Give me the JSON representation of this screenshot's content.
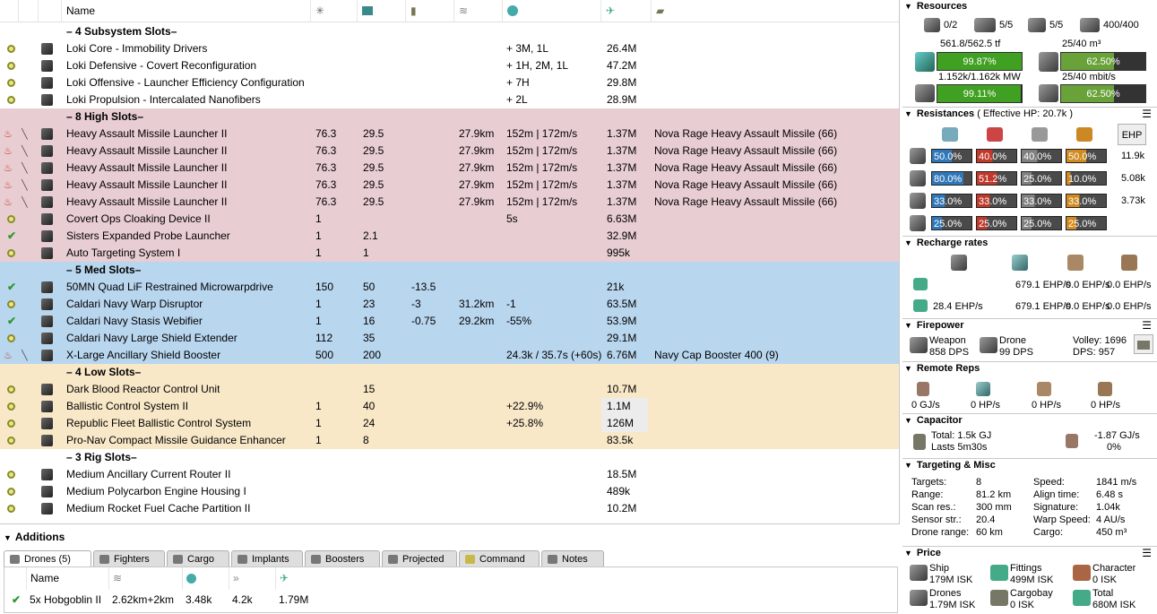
{
  "fitting": {
    "columns": {
      "name": "Name"
    },
    "rows": [
      {
        "type": "section",
        "label": "– 4 Subsystem Slots–",
        "bg": "white"
      },
      {
        "type": "mod",
        "state": "active",
        "name": "Loki Core - Immobility Drivers",
        "col5": "",
        "col6": "",
        "col7": "",
        "col8": "",
        "col9": "+ 3M, 1L",
        "price": "26.4M",
        "charge": "",
        "bg": "white"
      },
      {
        "type": "mod",
        "state": "active",
        "name": "Loki Defensive - Covert Reconfiguration",
        "col5": "",
        "col6": "",
        "col7": "",
        "col8": "",
        "col9": "+ 1H, 2M, 1L",
        "price": "47.2M",
        "charge": "",
        "bg": "white"
      },
      {
        "type": "mod",
        "state": "active",
        "name": "Loki Offensive - Launcher Efficiency Configuration",
        "col5": "",
        "col6": "",
        "col7": "",
        "col8": "",
        "col9": "+ 7H",
        "price": "29.8M",
        "charge": "",
        "bg": "white"
      },
      {
        "type": "mod",
        "state": "active",
        "name": "Loki Propulsion - Intercalated Nanofibers",
        "col5": "",
        "col6": "",
        "col7": "",
        "col8": "",
        "col9": "+ 2L",
        "price": "28.9M",
        "charge": "",
        "bg": "white"
      },
      {
        "type": "section",
        "label": "– 8 High Slots–",
        "bg": "pink"
      },
      {
        "type": "mod",
        "state": "overheat",
        "name": "Heavy Assault Missile Launcher II",
        "col5": "76.3",
        "col6": "29.5",
        "col7": "",
        "col8": "27.9km",
        "col9": "152m | 172m/s",
        "price": "1.37M",
        "charge": "Nova Rage Heavy Assault Missile (66)",
        "bg": "pink"
      },
      {
        "type": "mod",
        "state": "overheat",
        "name": "Heavy Assault Missile Launcher II",
        "col5": "76.3",
        "col6": "29.5",
        "col7": "",
        "col8": "27.9km",
        "col9": "152m | 172m/s",
        "price": "1.37M",
        "charge": "Nova Rage Heavy Assault Missile (66)",
        "bg": "pink"
      },
      {
        "type": "mod",
        "state": "overheat",
        "name": "Heavy Assault Missile Launcher II",
        "col5": "76.3",
        "col6": "29.5",
        "col7": "",
        "col8": "27.9km",
        "col9": "152m | 172m/s",
        "price": "1.37M",
        "charge": "Nova Rage Heavy Assault Missile (66)",
        "bg": "pink"
      },
      {
        "type": "mod",
        "state": "overheat",
        "name": "Heavy Assault Missile Launcher II",
        "col5": "76.3",
        "col6": "29.5",
        "col7": "",
        "col8": "27.9km",
        "col9": "152m | 172m/s",
        "price": "1.37M",
        "charge": "Nova Rage Heavy Assault Missile (66)",
        "bg": "pink"
      },
      {
        "type": "mod",
        "state": "overheat",
        "name": "Heavy Assault Missile Launcher II",
        "col5": "76.3",
        "col6": "29.5",
        "col7": "",
        "col8": "27.9km",
        "col9": "152m | 172m/s",
        "price": "1.37M",
        "charge": "Nova Rage Heavy Assault Missile (66)",
        "bg": "pink"
      },
      {
        "type": "mod",
        "state": "active",
        "name": "Covert Ops Cloaking Device II",
        "col5": "1",
        "col6": "",
        "col7": "",
        "col8": "",
        "col9": "5s",
        "price": "6.63M",
        "charge": "",
        "bg": "pink"
      },
      {
        "type": "mod",
        "state": "online",
        "name": "Sisters Expanded Probe Launcher",
        "col5": "1",
        "col6": "2.1",
        "col7": "",
        "col8": "",
        "col9": "",
        "price": "32.9M",
        "charge": "",
        "bg": "pink"
      },
      {
        "type": "mod",
        "state": "active",
        "name": "Auto Targeting System I",
        "col5": "1",
        "col6": "1",
        "col7": "",
        "col8": "",
        "col9": "",
        "price": "995k",
        "charge": "",
        "bg": "pink"
      },
      {
        "type": "section",
        "label": "– 5 Med Slots–",
        "bg": "blue"
      },
      {
        "type": "mod",
        "state": "online",
        "name": "50MN Quad LiF Restrained Microwarpdrive",
        "col5": "150",
        "col6": "50",
        "col7": "-13.5",
        "col8": "",
        "col9": "",
        "price": "21k",
        "charge": "",
        "bg": "blue"
      },
      {
        "type": "mod",
        "state": "active",
        "name": "Caldari Navy Warp Disruptor",
        "col5": "1",
        "col6": "23",
        "col7": "-3",
        "col8": "31.2km",
        "col9": "-1",
        "price": "63.5M",
        "charge": "",
        "bg": "blue"
      },
      {
        "type": "mod",
        "state": "online",
        "name": "Caldari Navy Stasis Webifier",
        "col5": "1",
        "col6": "16",
        "col7": "-0.75",
        "col8": "29.2km",
        "col9": "-55%",
        "price": "53.9M",
        "charge": "",
        "bg": "blue"
      },
      {
        "type": "mod",
        "state": "active",
        "name": "Caldari Navy Large Shield Extender",
        "col5": "112",
        "col6": "35",
        "col7": "",
        "col8": "",
        "col9": "",
        "price": "29.1M",
        "charge": "",
        "bg": "blue"
      },
      {
        "type": "mod",
        "state": "overheat",
        "name": "X-Large Ancillary Shield Booster",
        "col5": "500",
        "col6": "200",
        "col7": "",
        "col8": "",
        "col9": "24.3k / 35.7s (+60s)",
        "price": "6.76M",
        "charge": "Navy Cap Booster 400 (9)",
        "bg": "blue"
      },
      {
        "type": "section",
        "label": "– 4 Low Slots–",
        "bg": "tan"
      },
      {
        "type": "mod",
        "state": "active",
        "name": "Dark Blood Reactor Control Unit",
        "col5": "",
        "col6": "15",
        "col7": "",
        "col8": "",
        "col9": "",
        "price": "10.7M",
        "charge": "",
        "bg": "tan"
      },
      {
        "type": "mod",
        "state": "active",
        "name": "Ballistic Control System II",
        "col5": "1",
        "col6": "40",
        "col7": "",
        "col8": "",
        "col9": "+22.9%",
        "price": "1.1M",
        "charge": "",
        "bg": "tan",
        "pricebg": true
      },
      {
        "type": "mod",
        "state": "active",
        "name": "Republic Fleet Ballistic Control System",
        "col5": "1",
        "col6": "24",
        "col7": "",
        "col8": "",
        "col9": "+25.8%",
        "price": "126M",
        "charge": "",
        "bg": "tan",
        "pricebg": true
      },
      {
        "type": "mod",
        "state": "active",
        "name": "Pro-Nav Compact Missile Guidance Enhancer",
        "col5": "1",
        "col6": "8",
        "col7": "",
        "col8": "",
        "col9": "",
        "price": "83.5k",
        "charge": "",
        "bg": "tan"
      },
      {
        "type": "section",
        "label": "– 3 Rig Slots–",
        "bg": "white"
      },
      {
        "type": "mod",
        "state": "active",
        "name": "Medium Ancillary Current Router II",
        "col5": "",
        "col6": "",
        "col7": "",
        "col8": "",
        "col9": "",
        "price": "18.5M",
        "charge": "",
        "bg": "white"
      },
      {
        "type": "mod",
        "state": "active",
        "name": "Medium Polycarbon Engine Housing I",
        "col5": "",
        "col6": "",
        "col7": "",
        "col8": "",
        "col9": "",
        "price": "489k",
        "charge": "",
        "bg": "white"
      },
      {
        "type": "mod",
        "state": "active",
        "name": "Medium Rocket Fuel Cache Partition II",
        "col5": "",
        "col6": "",
        "col7": "",
        "col8": "",
        "col9": "",
        "price": "10.2M",
        "charge": "",
        "bg": "white"
      }
    ]
  },
  "additions": {
    "title": "Additions",
    "tabs": [
      "Drones (5)",
      "Fighters",
      "Cargo",
      "Implants",
      "Boosters",
      "Projected",
      "Command",
      "Notes"
    ],
    "drone_header": {
      "name": "Name"
    },
    "drone_row": {
      "name": "5x Hobgoblin II",
      "range": "2.62km+2km",
      "hp": "3.48k",
      "speed": "4.2k",
      "price": "1.79M"
    }
  },
  "resources": {
    "title": "Resources",
    "hardpoints": {
      "calib": "0/2",
      "turret": "5/5",
      "launcher": "5/5",
      "cal": "400/400"
    },
    "cpu_label": "561.8/562.5 tf",
    "cpu_pct": "99.87%",
    "drone_bay_label": "25/40 m³",
    "drone_bay_pct": "62.50%",
    "pg_label": "1.152k/1.162k MW",
    "pg_pct": "99.11%",
    "bandwidth_label": "25/40 mbit/s",
    "bandwidth_pct": "62.50%",
    "cpu_fill": 0.9987,
    "pg_fill": 0.9911,
    "drone_fill": 0.625,
    "bw_fill": 0.625
  },
  "resistances": {
    "title": "Resistances",
    "ehp_label": "( Effective HP: 20.7k )",
    "ehp_button": "EHP",
    "rows": [
      {
        "vals": [
          "50.0%",
          "40.0%",
          "40.0%",
          "50.0%"
        ],
        "ehp": "11.9k"
      },
      {
        "vals": [
          "80.0%",
          "51.2%",
          "25.0%",
          "10.0%"
        ],
        "ehp": "5.08k"
      },
      {
        "vals": [
          "33.0%",
          "33.0%",
          "33.0%",
          "33.0%"
        ],
        "ehp": "3.73k"
      },
      {
        "vals": [
          "25.0%",
          "25.0%",
          "25.0%",
          "25.0%"
        ],
        "ehp": ""
      }
    ]
  },
  "recharge": {
    "title": "Recharge rates",
    "row1": [
      "679.1 EHP/s",
      "0.0 EHP/s",
      "0.0 EHP/s"
    ],
    "row2": [
      "28.4 EHP/s",
      "679.1 EHP/s",
      "0.0 EHP/s",
      "0.0 EHP/s"
    ]
  },
  "firepower": {
    "title": "Firepower",
    "weapon_label": "Weapon",
    "weapon_dps": "858 DPS",
    "drone_label": "Drone",
    "drone_dps": "99 DPS",
    "volley": "Volley: 1696",
    "dps": "DPS: 957"
  },
  "remote": {
    "title": "Remote Reps",
    "vals": [
      "0 GJ/s",
      "0 HP/s",
      "0 HP/s",
      "0 HP/s"
    ]
  },
  "capacitor": {
    "title": "Capacitor",
    "total": "Total: 1.5k GJ",
    "lasts": "Lasts 5m30s",
    "delta": "-1.87 GJ/s",
    "pct": "0%"
  },
  "targeting": {
    "title": "Targeting & Misc",
    "left": [
      [
        "Targets:",
        "8"
      ],
      [
        "Range:",
        "81.2 km"
      ],
      [
        "Scan res.:",
        "300 mm"
      ],
      [
        "Sensor str.:",
        "20.4"
      ],
      [
        "Drone range:",
        "60 km"
      ]
    ],
    "right": [
      [
        "Speed:",
        "1841 m/s"
      ],
      [
        "Align time:",
        "6.48 s"
      ],
      [
        "Signature:",
        "1.04k"
      ],
      [
        "Warp Speed:",
        "4 AU/s"
      ],
      [
        "Cargo:",
        "450 m³"
      ]
    ]
  },
  "price": {
    "title": "Price",
    "ship_label": "Ship",
    "ship_val": "179M ISK",
    "fittings_label": "Fittings",
    "fittings_val": "499M ISK",
    "character_label": "Character",
    "character_val": "0 ISK",
    "drones_label": "Drones",
    "drones_val": "1.79M ISK",
    "cargobay_label": "Cargobay",
    "cargobay_val": "0 ISK",
    "total_label": "Total",
    "total_val": "680M ISK"
  },
  "colors": {
    "pink": "#e8cdd2",
    "blue": "#b9d6ef",
    "tan": "#f8e8c8",
    "cpu_green": "#3fa022",
    "drone_green": "#6aa23a",
    "em": "#2f77b8",
    "thermal": "#c0392b",
    "kinetic": "#808080",
    "explosive": "#d08a20"
  }
}
